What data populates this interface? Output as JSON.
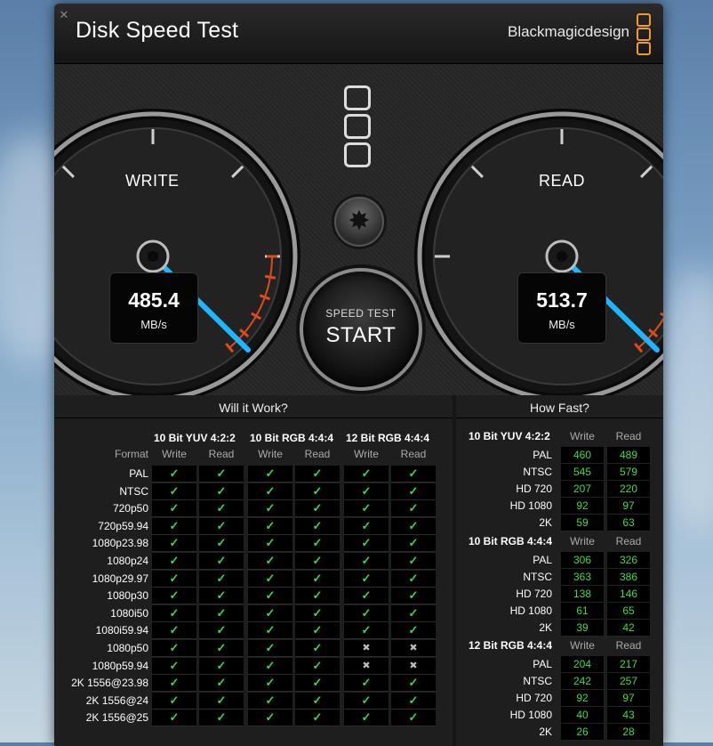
{
  "window": {
    "title": "Disk Speed Test",
    "brand": "Blackmagicdesign",
    "close_glyph": "✕"
  },
  "colors": {
    "accent_needle": "#1fb6ff",
    "redline": "#e04b1a",
    "check_green": "#3fd15a",
    "value_green": "#3fd94f",
    "logo_orange": "#f29a2e"
  },
  "gauges": {
    "write": {
      "label": "WRITE",
      "value": "485.4",
      "unit": "MB/s"
    },
    "read": {
      "label": "READ",
      "value": "513.7",
      "unit": "MB/s"
    }
  },
  "controls": {
    "settings_icon": "gear-icon",
    "settings_glyph": "✸",
    "start_small": "SPEED TEST",
    "start_big": "START"
  },
  "will_it_work": {
    "title": "Will it Work?",
    "format_header": "Format",
    "groups": [
      "10 Bit YUV 4:2:2",
      "10 Bit RGB 4:4:4",
      "12 Bit RGB 4:4:4"
    ],
    "sub_headers": [
      "Write",
      "Read",
      "Write",
      "Read",
      "Write",
      "Read"
    ],
    "ok_glyph": "✓",
    "no_glyph": "✖",
    "rows": [
      {
        "format": "PAL",
        "cells": [
          1,
          1,
          1,
          1,
          1,
          1
        ]
      },
      {
        "format": "NTSC",
        "cells": [
          1,
          1,
          1,
          1,
          1,
          1
        ]
      },
      {
        "format": "720p50",
        "cells": [
          1,
          1,
          1,
          1,
          1,
          1
        ]
      },
      {
        "format": "720p59.94",
        "cells": [
          1,
          1,
          1,
          1,
          1,
          1
        ]
      },
      {
        "format": "1080p23.98",
        "cells": [
          1,
          1,
          1,
          1,
          1,
          1
        ]
      },
      {
        "format": "1080p24",
        "cells": [
          1,
          1,
          1,
          1,
          1,
          1
        ]
      },
      {
        "format": "1080p29.97",
        "cells": [
          1,
          1,
          1,
          1,
          1,
          1
        ]
      },
      {
        "format": "1080p30",
        "cells": [
          1,
          1,
          1,
          1,
          1,
          1
        ]
      },
      {
        "format": "1080i50",
        "cells": [
          1,
          1,
          1,
          1,
          1,
          1
        ]
      },
      {
        "format": "1080i59.94",
        "cells": [
          1,
          1,
          1,
          1,
          1,
          1
        ]
      },
      {
        "format": "1080p50",
        "cells": [
          1,
          1,
          1,
          1,
          0,
          0
        ]
      },
      {
        "format": "1080p59.94",
        "cells": [
          1,
          1,
          1,
          1,
          0,
          0
        ]
      },
      {
        "format": "2K 1556@23.98",
        "cells": [
          1,
          1,
          1,
          1,
          1,
          1
        ]
      },
      {
        "format": "2K 1556@24",
        "cells": [
          1,
          1,
          1,
          1,
          1,
          1
        ]
      },
      {
        "format": "2K 1556@25",
        "cells": [
          1,
          1,
          1,
          1,
          1,
          1
        ]
      }
    ]
  },
  "how_fast": {
    "title": "How Fast?",
    "write_label": "Write",
    "read_label": "Read",
    "groups": [
      {
        "name": "10 Bit YUV 4:2:2",
        "rows": [
          {
            "format": "PAL",
            "write": "460",
            "read": "489"
          },
          {
            "format": "NTSC",
            "write": "545",
            "read": "579"
          },
          {
            "format": "HD 720",
            "write": "207",
            "read": "220"
          },
          {
            "format": "HD 1080",
            "write": "92",
            "read": "97"
          },
          {
            "format": "2K",
            "write": "59",
            "read": "63"
          }
        ]
      },
      {
        "name": "10 Bit RGB 4:4:4",
        "rows": [
          {
            "format": "PAL",
            "write": "306",
            "read": "326"
          },
          {
            "format": "NTSC",
            "write": "363",
            "read": "386"
          },
          {
            "format": "HD 720",
            "write": "138",
            "read": "146"
          },
          {
            "format": "HD 1080",
            "write": "61",
            "read": "65"
          },
          {
            "format": "2K",
            "write": "39",
            "read": "42"
          }
        ]
      },
      {
        "name": "12 Bit RGB 4:4:4",
        "rows": [
          {
            "format": "PAL",
            "write": "204",
            "read": "217"
          },
          {
            "format": "NTSC",
            "write": "242",
            "read": "257"
          },
          {
            "format": "HD 720",
            "write": "92",
            "read": "97"
          },
          {
            "format": "HD 1080",
            "write": "40",
            "read": "43"
          },
          {
            "format": "2K",
            "write": "26",
            "read": "28"
          }
        ]
      }
    ]
  }
}
